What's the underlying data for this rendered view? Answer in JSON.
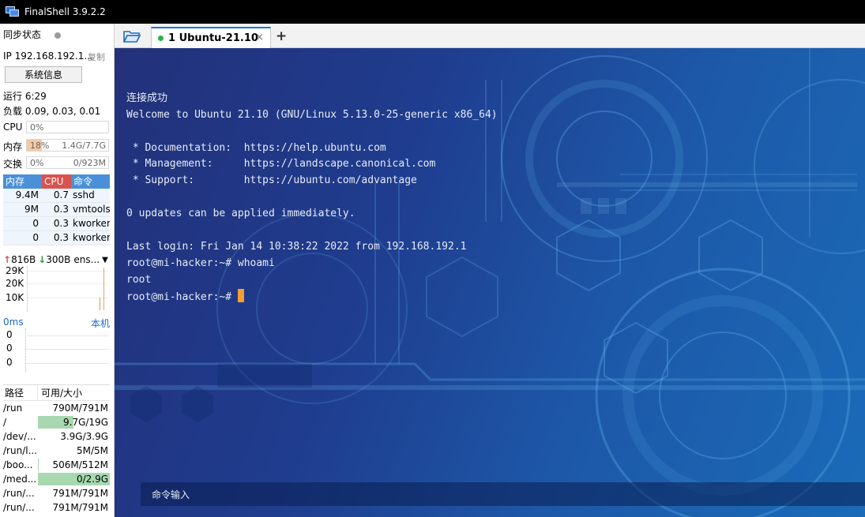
{
  "window": {
    "title": "FinalShell 3.9.2.2"
  },
  "sidebar": {
    "sync_status": "同步状态",
    "ip_label": "IP 192.168.192.1...",
    "copy": "复制",
    "sysinfo_button": "系统信息",
    "uptime": "运行 6:29",
    "load": "负载 0.09, 0.03, 0.01",
    "cpu": {
      "label": "CPU",
      "percent": "0%",
      "amount": ""
    },
    "mem": {
      "label": "内存",
      "percent": "18%",
      "amount": "1.4G/7.7G",
      "fill": 0.18
    },
    "swap": {
      "label": "交换",
      "percent": "0%",
      "amount": "0/923M"
    },
    "process_table": {
      "headers": [
        "内存",
        "CPU",
        "命令"
      ],
      "rows": [
        {
          "mem": "9.4M",
          "cpu": "0.7",
          "cmd": "sshd"
        },
        {
          "mem": "9M",
          "cpu": "0.3",
          "cmd": "vmtools"
        },
        {
          "mem": "0",
          "cpu": "0.3",
          "cmd": "kworker"
        },
        {
          "mem": "0",
          "cpu": "0.3",
          "cmd": "kworker"
        }
      ]
    },
    "network": {
      "up": "816B",
      "down": "300B",
      "interface": "ens...",
      "y_labels": [
        "29K",
        "20K",
        "10K"
      ]
    },
    "ping": {
      "ms": "0ms",
      "local": "本机",
      "y_labels": [
        "0",
        "0",
        "0"
      ]
    },
    "disk_table": {
      "headers": [
        "路径",
        "可用/大小"
      ],
      "rows": [
        {
          "path": "/run",
          "size": "790M/791M",
          "used": 0.0
        },
        {
          "path": "/",
          "size": "9.7G/19G",
          "used": 0.49
        },
        {
          "path": "/dev/...",
          "size": "3.9G/3.9G",
          "used": 0.0
        },
        {
          "path": "/run/l...",
          "size": "5M/5M",
          "used": 0.0
        },
        {
          "path": "/boo...",
          "size": "506M/512M",
          "used": 0.01
        },
        {
          "path": "/med...",
          "size": "0/2.9G",
          "used": 1.0
        },
        {
          "path": "/run/...",
          "size": "791M/791M",
          "used": 0.0
        },
        {
          "path": "/run/...",
          "size": "791M/791M",
          "used": 0.0
        }
      ]
    }
  },
  "tabs": [
    {
      "label": "1 Ubuntu-21.10",
      "active": true,
      "status_color": "#28b34a"
    }
  ],
  "terminal": {
    "lines": [
      "连接成功",
      "Welcome to Ubuntu 21.10 (GNU/Linux 5.13.0-25-generic x86_64)",
      "",
      " * Documentation:  https://help.ubuntu.com",
      " * Management:     https://landscape.canonical.com",
      " * Support:        https://ubuntu.com/advantage",
      "",
      "0 updates can be applied immediately.",
      "",
      "Last login: Fri Jan 14 10:38:22 2022 from 192.168.192.1",
      "root@mi-hacker:~# whoami",
      "root"
    ],
    "prompt": "root@mi-hacker:~# ",
    "cursor_color": "#f0a030"
  },
  "command_input": {
    "placeholder": "命令输入"
  },
  "colors": {
    "accent": "#1a73e8",
    "mem_fill": "#f5c9a3",
    "cpu_header": "#d9534f",
    "mem_header": "#4a90d9",
    "disk_bar": "#a8d8b0"
  }
}
